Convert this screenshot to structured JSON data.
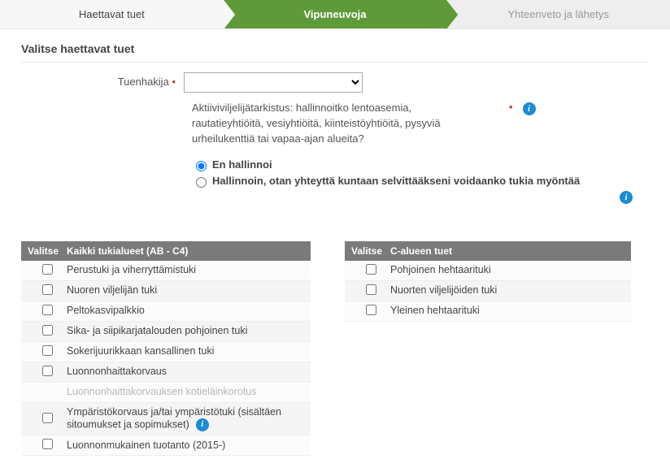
{
  "steps": {
    "s1": "Haettavat tuet",
    "s2": "Vipuneuvoja",
    "s3": "Yhteenveto ja lähetys"
  },
  "section_title": "Valitse haettavat tuet",
  "applicant": {
    "label": "Tuenhakija",
    "value": ""
  },
  "question": "Aktiiviviljelijätarkistus: hallinnoitko lentoasemia, rautatieyhtiöitä, vesiyhtiöitä, kiinteistöyhtiöitä, pysyviä urheilukenttiä tai vapaa-ajan alueita?",
  "radio": {
    "no": "En hallinnoi",
    "yes": "Hallinnoin, otan yhteyttä kuntaan selvittääkseni voidaanko tukia myöntää"
  },
  "left_table": {
    "col_valitse": "Valitse",
    "col_title": "Kaikki tukialueet (AB - C4)",
    "rows": [
      {
        "label": "Perustuki ja viherryttämistuki",
        "disabled": false,
        "info": false
      },
      {
        "label": "Nuoren viljelijän tuki",
        "disabled": false,
        "info": false
      },
      {
        "label": "Peltokasvipalkkio",
        "disabled": false,
        "info": false
      },
      {
        "label": "Sika- ja siipikarjatalouden pohjoinen tuki",
        "disabled": false,
        "info": false
      },
      {
        "label": "Sokerijuurikkaan kansallinen tuki",
        "disabled": false,
        "info": false
      },
      {
        "label": "Luonnonhaittakorvaus",
        "disabled": false,
        "info": false
      },
      {
        "label": "Luonnonhaittakorvauksen kotieläinkorotus",
        "disabled": true,
        "info": false
      },
      {
        "label": "Ympäristökorvaus ja/tai ympäristötuki (sisältäen sitoumukset ja sopimukset)",
        "disabled": false,
        "info": true
      },
      {
        "label": "Luonnonmukainen tuotanto (2015-)",
        "disabled": false,
        "info": false
      }
    ]
  },
  "right_table": {
    "col_valitse": "Valitse",
    "col_title": "C-alueen tuet",
    "rows": [
      {
        "label": "Pohjoinen hehtaarituki",
        "disabled": false,
        "info": false
      },
      {
        "label": "Nuorten viljelijöiden tuki",
        "disabled": false,
        "info": false
      },
      {
        "label": "Yleinen hehtaarituki",
        "disabled": false,
        "info": false
      }
    ]
  },
  "required_marker": "•"
}
